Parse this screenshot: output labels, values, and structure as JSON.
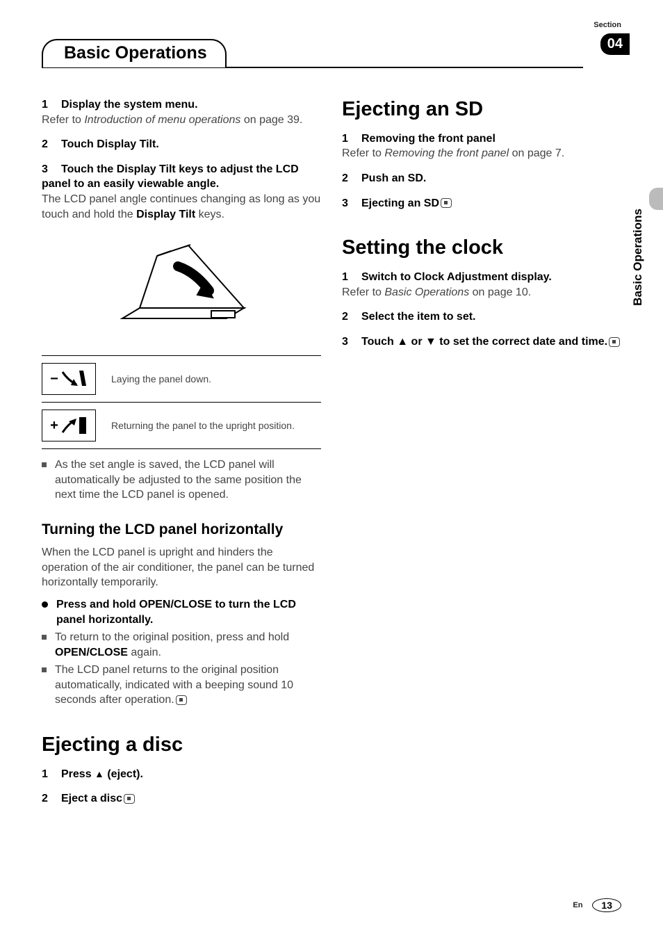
{
  "header": {
    "section_label": "Section",
    "section_number": "04",
    "tab_title": "Basic Operations"
  },
  "side": {
    "label": "Basic Operations"
  },
  "left": {
    "step1": {
      "num": "1",
      "title": "Display the system menu.",
      "body_pre": "Refer to ",
      "body_italic": "Introduction of menu operations",
      "body_post": " on page 39."
    },
    "step2": {
      "num": "2",
      "title": "Touch Display Tilt."
    },
    "step3": {
      "num": "3",
      "title": "Touch the Display Tilt keys to adjust the LCD panel to an easily viewable angle.",
      "body_pre": "The LCD panel angle continues changing as long as you touch and hold the ",
      "body_bold": "Display Tilt",
      "body_post": " keys."
    },
    "icon_down": {
      "sign": "−",
      "desc": "Laying the panel down."
    },
    "icon_up": {
      "sign": "+",
      "desc": "Returning the panel to the upright position."
    },
    "note_saved": "As the set angle is saved, the LCD panel will automatically be adjusted to the same position the next time the LCD panel is opened.",
    "h2_turning": "Turning the LCD panel horizontally",
    "turning_body": "When the LCD panel is upright and hinders the operation of the air conditioner, the panel can be turned horizontally temporarily.",
    "press_hold": "Press and hold OPEN/CLOSE to turn the LCD panel horizontally.",
    "return_pre": "To return to the original position, press and hold ",
    "return_bold": "OPEN/CLOSE",
    "return_post": " again.",
    "auto_return": "The LCD panel returns to the original position automatically, indicated with a beeping sound 10 seconds after operation.",
    "h1_eject_disc": "Ejecting a disc",
    "eject_step1": {
      "num": "1",
      "title_pre": "Press ",
      "title_post": " (eject)."
    },
    "eject_step2": {
      "num": "2",
      "title": "Eject a disc"
    }
  },
  "right": {
    "h1_eject_sd": "Ejecting an SD",
    "sd_step1": {
      "num": "1",
      "title": "Removing the front panel",
      "body_pre": "Refer to ",
      "body_italic": "Removing the front panel",
      "body_post": " on page 7."
    },
    "sd_step2": {
      "num": "2",
      "title": "Push an SD."
    },
    "sd_step3": {
      "num": "3",
      "title": "Ejecting an SD"
    },
    "h1_clock": "Setting the clock",
    "clock_step1": {
      "num": "1",
      "title": "Switch to Clock Adjustment display.",
      "body_pre": "Refer to ",
      "body_italic": "Basic Operations",
      "body_post": " on page 10."
    },
    "clock_step2": {
      "num": "2",
      "title": "Select the item to set."
    },
    "clock_step3": {
      "num": "3",
      "title_pre": "Touch ",
      "title_mid": " or ",
      "title_post": " to set the correct date and time."
    }
  },
  "footer": {
    "lang": "En",
    "page": "13"
  }
}
